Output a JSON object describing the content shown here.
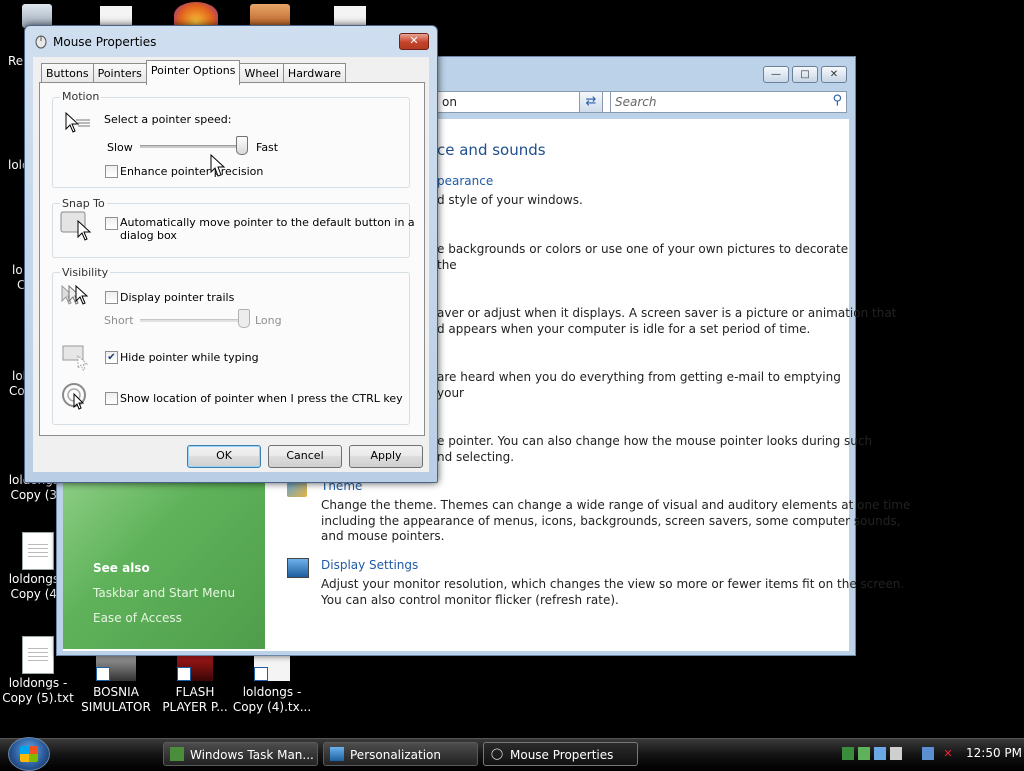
{
  "desktop": {
    "edge_labels": [
      "Re",
      "lold",
      "lo",
      "C",
      "lol",
      "Co"
    ],
    "icons": [
      {
        "label": "loldongs -\nCopy (3)."
      },
      {
        "label": "loldongs -\nCopy (4)."
      },
      {
        "label": "loldongs -\nCopy (5).txt"
      },
      {
        "label": "BOSNIA\nSIMULATOR"
      },
      {
        "label": "FLASH\nPLAYER P..."
      },
      {
        "label": "loldongs -\nCopy (4).tx..."
      }
    ]
  },
  "personalization": {
    "address_text": "on",
    "search_placeholder": "Search",
    "heading": "ce and sounds",
    "sections": [
      {
        "link": "pearance",
        "text": "d style of your windows."
      },
      {
        "link": "",
        "text": "e backgrounds or colors or use one of your own pictures to decorate the"
      },
      {
        "link": "",
        "text": "aver or adjust when it displays. A screen saver is a picture or animation that\nd appears when your computer is idle for a set period of time."
      },
      {
        "link": "",
        "text": "are heard when you do everything from getting e-mail to emptying your"
      },
      {
        "link": "",
        "text": "e pointer. You can also change how the mouse pointer looks during such\nnd selecting."
      },
      {
        "link": "Theme",
        "text": "Change the theme. Themes can change a wide range of visual and auditory elements at one time\nincluding the appearance of menus, icons, backgrounds, screen savers, some computer sounds,\nand mouse pointers."
      },
      {
        "link": "Display Settings",
        "text": "Adjust your monitor resolution, which changes the view so more or fewer items fit on the screen.\nYou can also control monitor flicker (refresh rate)."
      }
    ],
    "see_also": {
      "title": "See also",
      "links": [
        "Taskbar and Start Menu",
        "Ease of Access"
      ]
    }
  },
  "mouse_properties": {
    "title": "Mouse Properties",
    "tabs": [
      "Buttons",
      "Pointers",
      "Pointer Options",
      "Wheel",
      "Hardware"
    ],
    "active_tab": "Pointer Options",
    "motion": {
      "group_title": "Motion",
      "speed_label": "Select a pointer speed:",
      "slow": "Slow",
      "fast": "Fast",
      "speed_value": 0.98,
      "enhance_label": "Enhance pointer precision",
      "enhance_checked": false
    },
    "snap_to": {
      "group_title": "Snap To",
      "label": "Automatically move pointer to the default button in a\ndialog box",
      "checked": false
    },
    "visibility": {
      "group_title": "Visibility",
      "trails_label": "Display pointer trails",
      "trails_checked": false,
      "short": "Short",
      "long": "Long",
      "trails_value": 1.0,
      "hide_label": "Hide pointer while typing",
      "hide_checked": true,
      "ctrl_label": "Show location of pointer when I press the CTRL key",
      "ctrl_checked": false
    },
    "buttons": {
      "ok": "OK",
      "cancel": "Cancel",
      "apply": "Apply"
    }
  },
  "taskbar": {
    "items": [
      {
        "label": "Windows Task Man...",
        "active": false
      },
      {
        "label": "Personalization",
        "active": false
      },
      {
        "label": "Mouse Properties",
        "active": true
      }
    ],
    "clock": "12:50 PM"
  }
}
